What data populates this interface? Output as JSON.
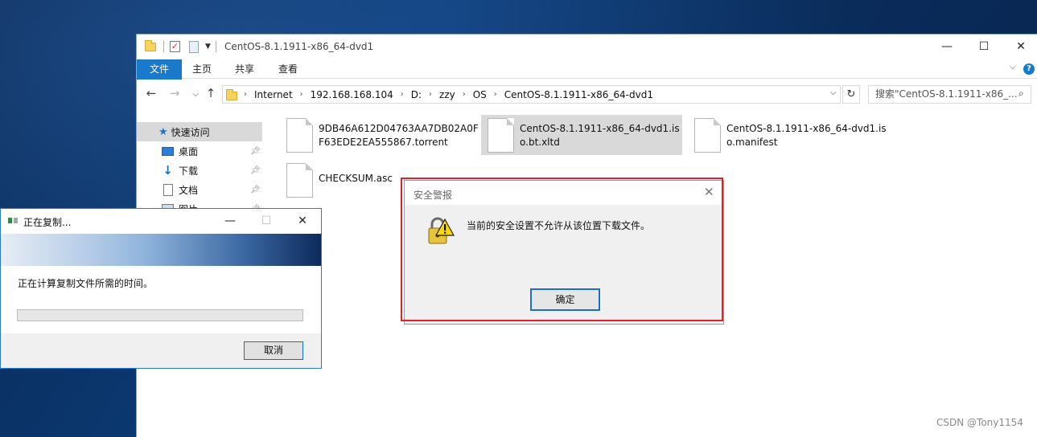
{
  "explorer": {
    "title": "CentOS-8.1.1911-x86_64-dvd1",
    "ribbon_tabs": [
      "文件",
      "主页",
      "共享",
      "查看"
    ],
    "breadcrumb": [
      "Internet",
      "192.168.168.104",
      "D:",
      "zzy",
      "OS",
      "CentOS-8.1.1911-x86_64-dvd1"
    ],
    "search_placeholder": "搜索\"CentOS-8.1.1911-x86_...",
    "nav_items": [
      {
        "label": "快速访问",
        "icon": "star-icon",
        "selected": true
      },
      {
        "label": "桌面",
        "icon": "desktop-icon",
        "pinned": true
      },
      {
        "label": "下载",
        "icon": "download-icon",
        "pinned": true
      },
      {
        "label": "文档",
        "icon": "document-icon",
        "pinned": true
      },
      {
        "label": "图片",
        "icon": "picture-icon",
        "pinned": true
      }
    ],
    "files": [
      {
        "name": "9DB46A612D04763AA7DB02A0FF63EDE2EA555867.torrent",
        "selected": false
      },
      {
        "name": "CentOS-8.1.1911-x86_64-dvd1.iso.bt.xltd",
        "selected": true
      },
      {
        "name": "CentOS-8.1.1911-x86_64-dvd1.iso.manifest",
        "selected": false
      },
      {
        "name": "CHECKSUM.asc",
        "selected": false
      }
    ]
  },
  "copy_dialog": {
    "title": "正在复制...",
    "message": "正在计算复制文件所需的时间。",
    "progress": 0,
    "cancel_label": "取消"
  },
  "security_alert": {
    "title": "安全警报",
    "message": "当前的安全设置不允许从该位置下载文件。",
    "ok_label": "确定",
    "icon": "lock-warning-icon"
  },
  "watermark": "CSDN @Tony1154",
  "colors": {
    "accent": "#1979ca",
    "highlight_frame": "#e0202a",
    "selection": "#d9d9d9"
  }
}
